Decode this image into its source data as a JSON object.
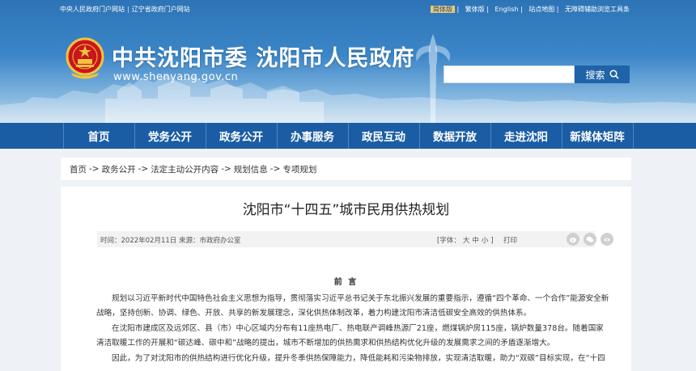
{
  "topbar": {
    "left_links": [
      "中央人民政府门户网站",
      "辽宁省政府门户网站"
    ],
    "right_links": [
      "简体版",
      "繁体版",
      "English",
      "站点地图",
      "无障碍辅助浏览工具条"
    ]
  },
  "header": {
    "site_title": "中共沈阳市委  沈阳市人民政府",
    "site_url": "www.shenyang.gov.cn",
    "search_placeholder": "",
    "search_label": "搜索"
  },
  "nav": [
    "首页",
    "党务公开",
    "政务公开",
    "办事服务",
    "政民互动",
    "数据开放",
    "走进沈阳",
    "新媒体矩阵"
  ],
  "breadcrumb": [
    "首页",
    "政务公开",
    "法定主动公开内容",
    "规划信息",
    "专项规划"
  ],
  "breadcrumb_sep": "->",
  "article": {
    "title": "沈阳市“十四五”城市民用供热规划",
    "meta_time": "时间：2022年02月11日   来源：市政府办公室",
    "font_label": "[字体：",
    "font_sizes": [
      "大",
      "中",
      "小"
    ],
    "font_close": "]",
    "print_label": "打印",
    "preface": "前  言",
    "paragraphs": [
      "规划以习近平新时代中国特色社会主义思想为指导，贯彻落实习近平总书记关于东北振兴发展的重要指示，遵循“四个革命、一个合作”能源安全新战略，坚持创新、协调、绿色、开放、共享的新发展理念，深化供热体制改革，着力构建沈阳市清洁低碳安全高效的供热体系。",
      "在沈阳市建成区及远郊区、县（市）中心区域内分布有11座热电厂、热电联产调峰热源厂21座，燃煤锅炉房115座，锅炉数量378台。随着国家清洁取暖工作的开展和“碳达峰、碳中和”战略的提出，城市不断增加的供热需求和供热结构优化升级的发展需求之间的矛盾逐渐增大。",
      "因此，为了对沈阳市的供热结构进行优化升级，提升冬季供热保障能力，降低能耗和污染物排放，实现清洁取暖，助力“双碳”目标实现，在“十四"
    ]
  },
  "colors": {
    "nav_bg": "#1b5da4",
    "header_top": "#2d74b6",
    "search_btn": "#1f63a8",
    "emblem_red": "#c8161d",
    "emblem_gold": "#f3c33c"
  },
  "icons": [
    "national-emblem-icon",
    "search-icon",
    "weibo-share-icon",
    "wechat-share-icon",
    "qq-share-icon"
  ]
}
